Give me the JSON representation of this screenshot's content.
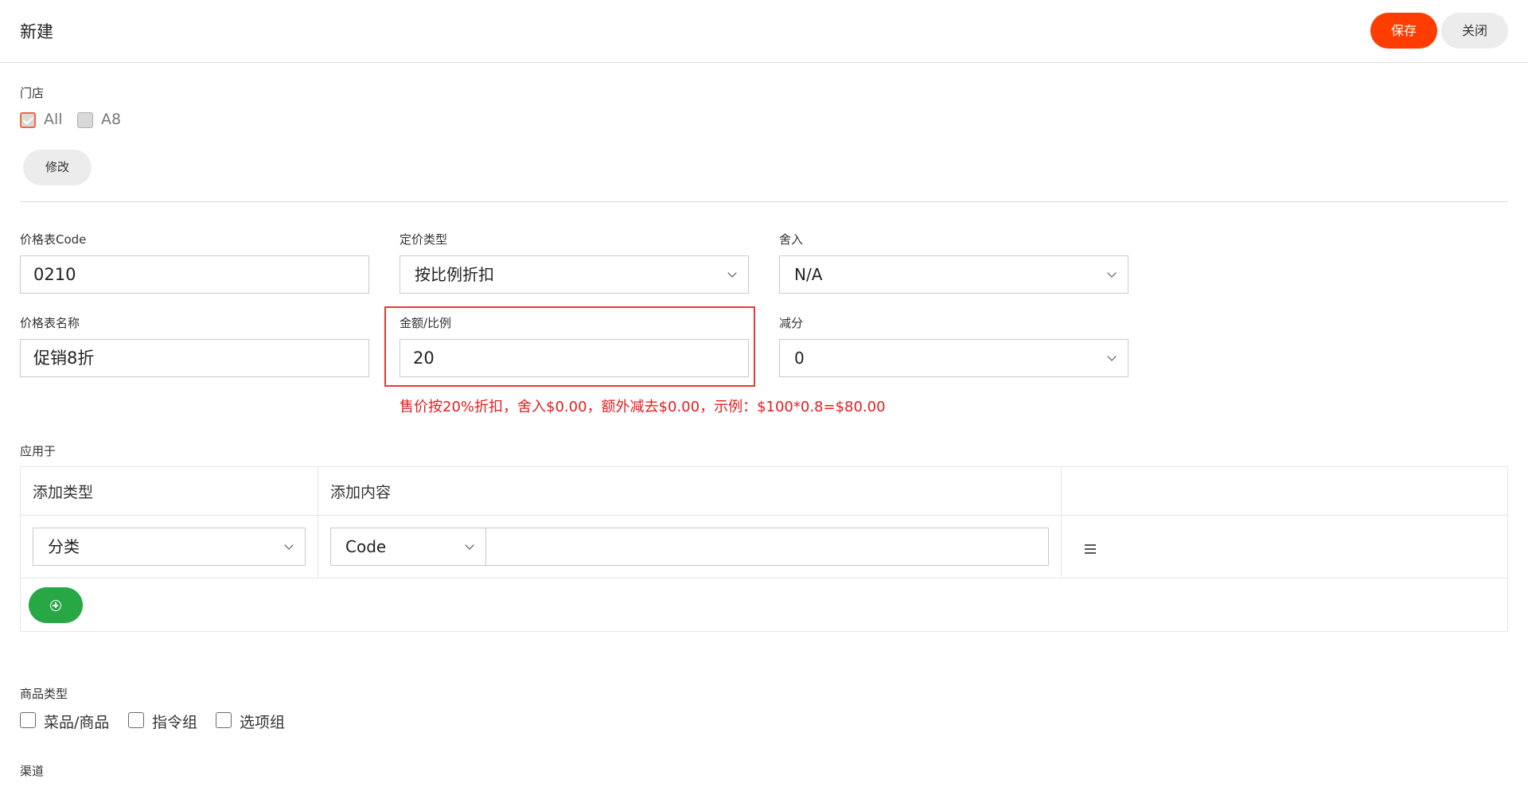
{
  "header": {
    "title": "新建",
    "save_label": "保存",
    "close_label": "关闭"
  },
  "store": {
    "label": "门店",
    "options": [
      {
        "label": "All",
        "checked": true
      },
      {
        "label": "A8",
        "checked": false
      }
    ],
    "modify_label": "修改"
  },
  "form": {
    "code_label": "价格表Code",
    "code_value": "0210",
    "pricing_type_label": "定价类型",
    "pricing_type_value": "按比例折扣",
    "rounding_label": "舍入",
    "rounding_value": "N/A",
    "name_label": "价格表名称",
    "name_value": "促销8折",
    "amount_label": "金额/比例",
    "amount_value": "20",
    "deduct_label": "减分",
    "deduct_value": "0",
    "hint": "售价按20%折扣，舍入$0.00，额外减去$0.00，示例：$100*0.8=$80.00"
  },
  "apply_to": {
    "label": "应用于",
    "col_type": "添加类型",
    "col_content": "添加内容",
    "row": {
      "type_value": "分类",
      "field_value": "Code",
      "content_value": ""
    }
  },
  "product_type": {
    "label": "商品类型",
    "options": [
      "菜品/商品",
      "指令组",
      "选项组"
    ]
  },
  "channel": {
    "label": "渠道"
  },
  "icons": {
    "menu": "menu-icon",
    "add": "plus-circle-icon",
    "chevron": "chevron-down-icon"
  },
  "colors": {
    "accent": "#ff3d00",
    "success": "#28a745",
    "error": "#e02020"
  }
}
